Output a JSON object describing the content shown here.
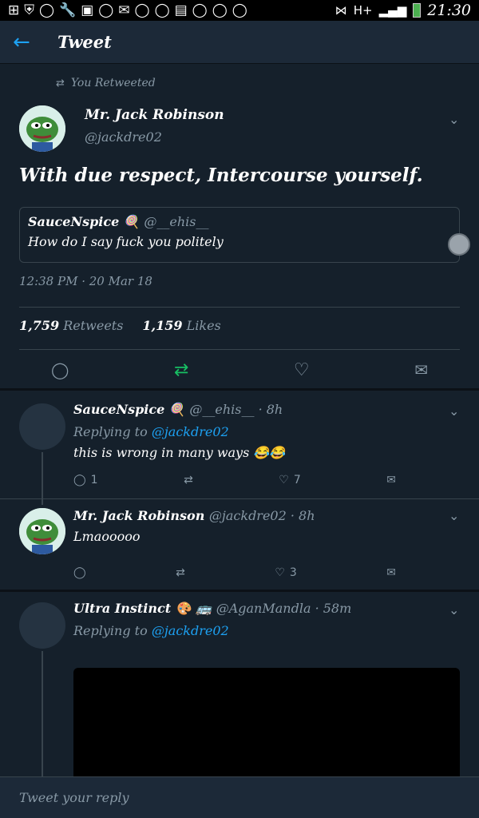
{
  "status_bar": {
    "time": "21:30",
    "network": "H+"
  },
  "header": {
    "back_icon": "arrow-left-icon",
    "title": "Tweet"
  },
  "main_tweet": {
    "retweet_label": "You Retweeted",
    "name": "Mr. Jack Robinson",
    "handle": "@jackdre02",
    "text": "With due respect, Intercourse yourself.",
    "quote": {
      "name": "SauceNspice 🍭",
      "handle": "@__ehis__",
      "text": "How do I say fuck you politely"
    },
    "timestamp": "12:38 PM · 20 Mar 18",
    "retweets_count": "1,759",
    "retweets_label": "Retweets",
    "likes_count": "1,159",
    "likes_label": "Likes"
  },
  "replies": [
    {
      "name": "SauceNspice 🍭",
      "meta": "@__ehis__ · 8h",
      "replying_prefix": "Replying to",
      "replying_to": "@jackdre02",
      "text": "this is wrong in many ways 😂😂",
      "reply_count": "1",
      "retweet_count": "",
      "like_count": "7"
    },
    {
      "name": "Mr. Jack Robinson",
      "meta": "@jackdre02 · 8h",
      "text": "Lmaooooo",
      "reply_count": "",
      "retweet_count": "",
      "like_count": "3"
    },
    {
      "name": "Ultra Instinct 🎨 🚌",
      "meta": "@AganMandla · 58m",
      "replying_prefix": "Replying to",
      "replying_to": "@jackdre02"
    }
  ],
  "composer": {
    "placeholder": "Tweet your reply"
  },
  "colors": {
    "background": "#15202b",
    "accent": "#1da1f2",
    "retweet_green": "#17bf63",
    "muted": "#8899a6"
  }
}
